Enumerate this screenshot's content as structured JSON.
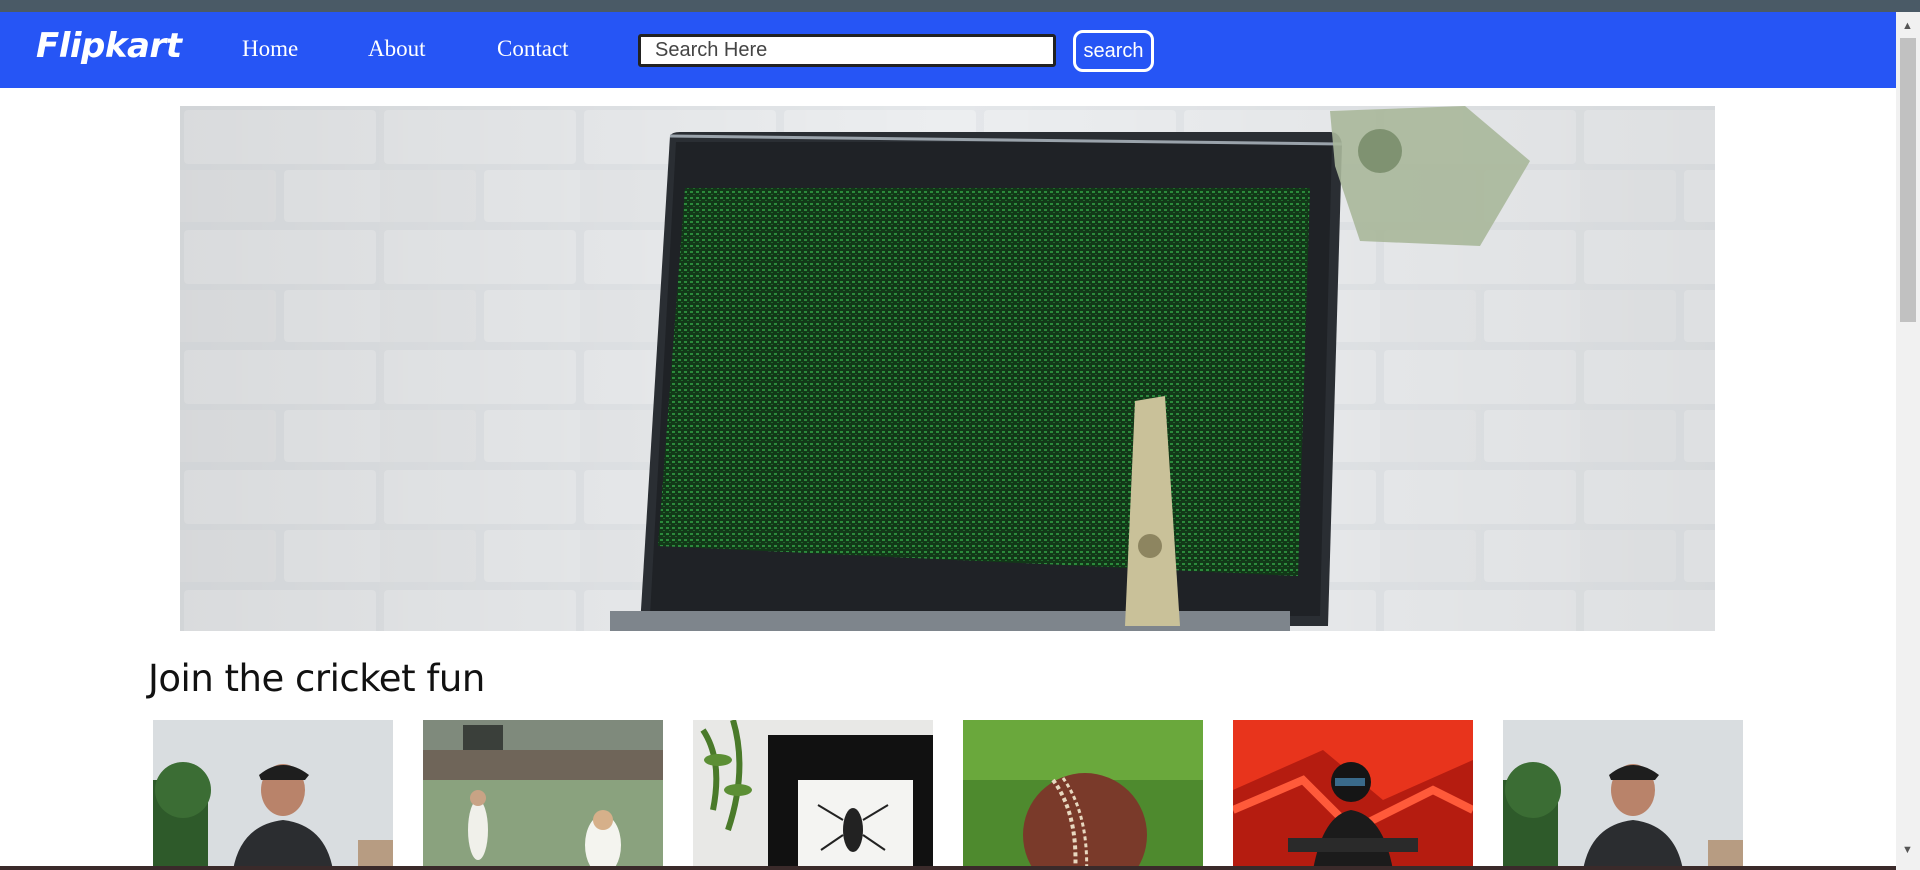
{
  "nav": {
    "logo": "Flipkart",
    "links": [
      "Home",
      "About",
      "Contact"
    ],
    "search_placeholder": "Search Here",
    "search_button": "search"
  },
  "hero": {
    "icon": "laptop-with-money-image"
  },
  "section": {
    "title": "Join the cricket fun",
    "cards": [
      {
        "icon": "man-in-cap-image"
      },
      {
        "icon": "cricket-match-image"
      },
      {
        "icon": "insect-art-frame-image"
      },
      {
        "icon": "cricket-ball-on-grass-image"
      },
      {
        "icon": "motorcyclist-red-image"
      },
      {
        "icon": "man-in-cap-image"
      }
    ]
  },
  "colors": {
    "navbar": "#2655f5",
    "white": "#ffffff"
  }
}
